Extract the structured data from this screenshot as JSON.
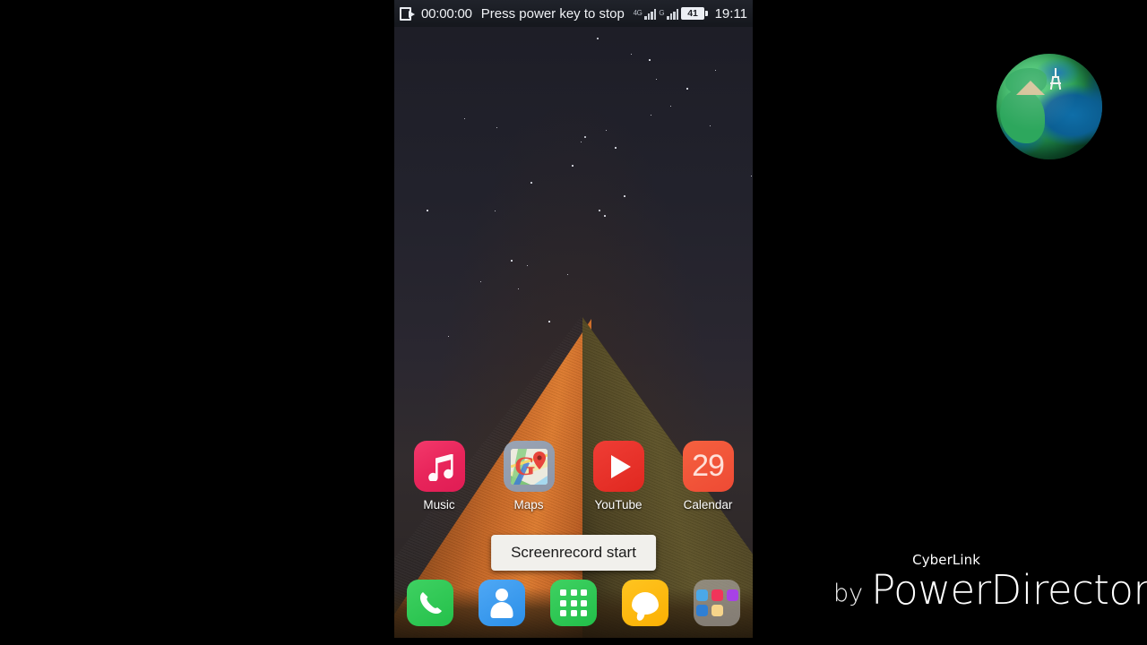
{
  "device": {
    "status_bar": {
      "record_icon": "screen-record-icon",
      "record_time": "00:00:00",
      "record_message": "Press power key to stop",
      "network_label_1": "4G",
      "network_label_2": "G",
      "signal_bars_1": 4,
      "signal_bars_2": 4,
      "battery_percent": "41",
      "clock": "19:11"
    },
    "wallpaper": {
      "description": "night-sky-pyramid-wallpaper"
    },
    "app_row": [
      {
        "label": "Music",
        "icon": "music-note-icon",
        "color": "#e8255b"
      },
      {
        "label": "Maps",
        "icon": "google-maps-icon",
        "color": "#8c96a8"
      },
      {
        "label": "YouTube",
        "icon": "youtube-play-icon",
        "color": "#e02820"
      },
      {
        "label": "Calendar",
        "icon": "calendar-icon",
        "color": "#ee4a34",
        "day": "29"
      }
    ],
    "toast": {
      "message": "Screenrecord start"
    },
    "dock": [
      {
        "label": "Phone",
        "icon": "phone-handset-icon"
      },
      {
        "label": "Contacts",
        "icon": "contacts-person-icon"
      },
      {
        "label": "Apps",
        "icon": "app-drawer-grid-icon"
      },
      {
        "label": "Messages",
        "icon": "message-bubble-icon"
      },
      {
        "label": "Folder",
        "icon": "app-folder-icon",
        "mini_icons": [
          "#4aa8e8",
          "#f0355a",
          "#a741e6",
          "#2f7fd4",
          "#f6d48a"
        ]
      }
    ]
  },
  "overlay": {
    "watermark": {
      "by": "by",
      "brand_small": "CyberLink",
      "brand_main": "PowerDirector"
    },
    "logo": {
      "name": "green-globe-logo"
    }
  }
}
